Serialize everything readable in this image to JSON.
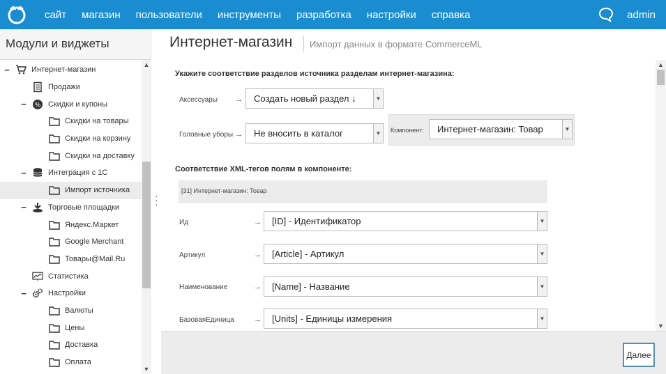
{
  "topbar": {
    "nav": [
      "сайт",
      "магазин",
      "пользователи",
      "инструменты",
      "разработка",
      "настройки",
      "справка"
    ],
    "user": "admin",
    "logo_icon": "logo-icon",
    "chat_icon": "chat-bubble-icon",
    "color": "#1a8dd1"
  },
  "sidebar": {
    "title": "Модули и виджеты",
    "items": [
      {
        "label": "Интернет-магазин",
        "icon": "cart-icon",
        "toggle": "−"
      },
      {
        "label": "Продажи",
        "icon": "document-icon",
        "toggle": ""
      },
      {
        "label": "Скидки и купоны",
        "icon": "percent-icon",
        "toggle": "−"
      },
      {
        "label": "Скидки на товары",
        "icon": "folder-icon",
        "toggle": ""
      },
      {
        "label": "Скидки на корзину",
        "icon": "folder-icon",
        "toggle": ""
      },
      {
        "label": "Скидки на доставку",
        "icon": "folder-icon",
        "toggle": ""
      },
      {
        "label": "Интеграция с 1С",
        "icon": "database-icon",
        "toggle": "−"
      },
      {
        "label": "Импорт источника",
        "icon": "folder-icon",
        "toggle": "",
        "selected": true
      },
      {
        "label": "Торговые площадки",
        "icon": "marketplace-icon",
        "toggle": "−"
      },
      {
        "label": "Яндекс.Маркет",
        "icon": "folder-icon",
        "toggle": ""
      },
      {
        "label": "Google Merchant",
        "icon": "folder-icon",
        "toggle": ""
      },
      {
        "label": "Товары@Mail.Ru",
        "icon": "folder-icon",
        "toggle": ""
      },
      {
        "label": "Статистика",
        "icon": "chart-icon",
        "toggle": ""
      },
      {
        "label": "Настройки",
        "icon": "gears-icon",
        "toggle": "−"
      },
      {
        "label": "Валюты",
        "icon": "folder-icon",
        "toggle": ""
      },
      {
        "label": "Цены",
        "icon": "folder-icon",
        "toggle": ""
      },
      {
        "label": "Доставка",
        "icon": "folder-icon",
        "toggle": ""
      },
      {
        "label": "Оплата",
        "icon": "folder-icon",
        "toggle": ""
      }
    ]
  },
  "page": {
    "title": "Интернет-магазин",
    "subtitle": "Импорт данных в формате CommerceML"
  },
  "form": {
    "sections_heading": "Укажите соответствие разделов источника разделам интернет-магазина:",
    "arrow": "→",
    "row1": {
      "label": "Аксессуары",
      "value": "Создать новый раздел  ↓",
      "component_label": "Компонент:",
      "component_value": "Интернет-магазин: Товар"
    },
    "row2": {
      "label": "Головные уборы",
      "value": "Не вносить в каталог"
    },
    "xml_heading": "Соответствие XML-тегов полям в компоненте:",
    "component_header": "[31] Интернет-магазин: Товар",
    "fields": [
      {
        "label": "Ид",
        "value": "[ID] - Идентификатор"
      },
      {
        "label": "Артикул",
        "value": "[Article] - Артикул"
      },
      {
        "label": "Наименование",
        "value": "[Name] - Название"
      },
      {
        "label": "БазоваяЕдиница",
        "value": "[Units] - Единицы измерения"
      }
    ]
  },
  "footer": {
    "next_label": "Далее"
  }
}
